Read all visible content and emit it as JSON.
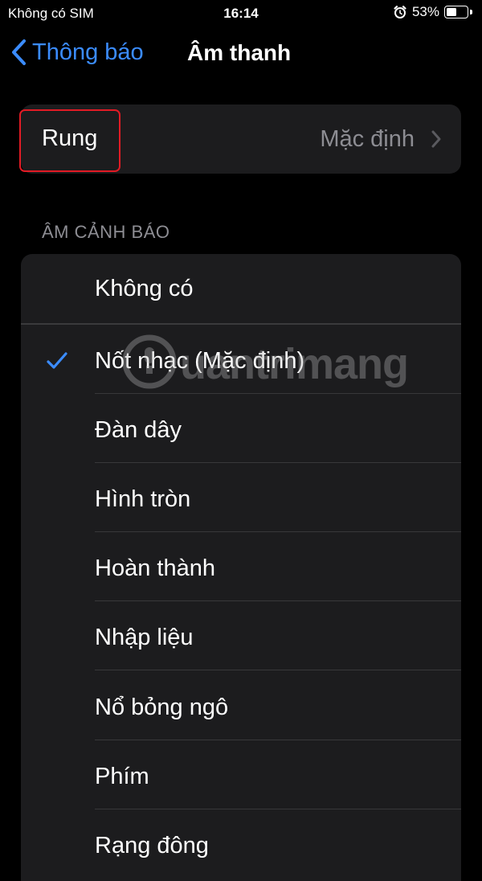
{
  "status_bar": {
    "carrier": "Không có SIM",
    "time": "16:14",
    "battery_percent": "53%",
    "battery_level": 0.53,
    "alarm_icon": "alarm-clock-icon"
  },
  "nav": {
    "back_label": "Thông báo",
    "title": "Âm thanh"
  },
  "vibration": {
    "label": "Rung",
    "value": "Mặc định"
  },
  "alert_tones": {
    "header": "ÂM CẢNH BÁO",
    "none_label": "Không có",
    "items": [
      {
        "label": "Nốt nhạc (Mặc định)",
        "selected": true
      },
      {
        "label": "Đàn dây",
        "selected": false
      },
      {
        "label": "Hình tròn",
        "selected": false
      },
      {
        "label": "Hoàn thành",
        "selected": false
      },
      {
        "label": "Nhập liệu",
        "selected": false
      },
      {
        "label": "Nổ bỏng ngô",
        "selected": false
      },
      {
        "label": "Phím",
        "selected": false
      },
      {
        "label": "Rạng đông",
        "selected": false
      }
    ]
  },
  "watermark": {
    "text": "uantrimang"
  },
  "colors": {
    "accent": "#3b8cff",
    "highlight": "#e21b25",
    "cell_background": "#1c1c1e",
    "secondary_text": "#8d8d93"
  }
}
